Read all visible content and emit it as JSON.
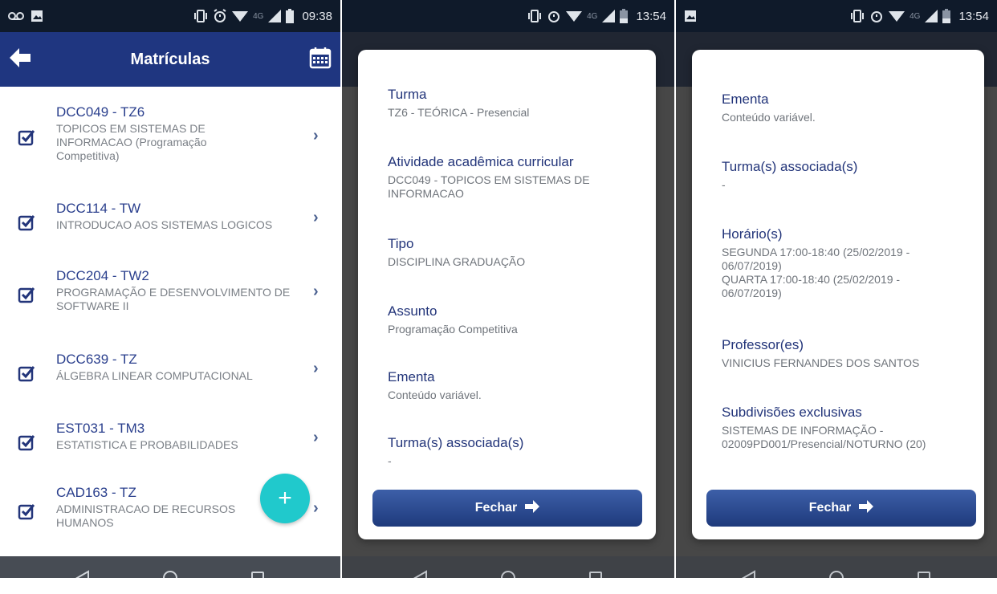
{
  "screens": [
    {
      "status": {
        "time": "09:38",
        "network": "4G"
      },
      "header": {
        "title": "Matrículas"
      },
      "items": [
        {
          "code": "DCC049 - TZ6",
          "desc": "TOPICOS EM SISTEMAS DE INFORMACAO (Programação Competitiva)"
        },
        {
          "code": "DCC114 - TW",
          "desc": "INTRODUCAO AOS SISTEMAS LOGICOS"
        },
        {
          "code": "DCC204 - TW2",
          "desc": "PROGRAMAÇÃO E DESENVOLVIMENTO DE SOFTWARE II"
        },
        {
          "code": "DCC639 - TZ",
          "desc": "ÁLGEBRA LINEAR COMPUTACIONAL"
        },
        {
          "code": "EST031 - TM3",
          "desc": "ESTATISTICA E PROBABILIDADES"
        },
        {
          "code": "CAD163 - TZ",
          "desc": "ADMINISTRACAO DE RECURSOS HUMANOS"
        }
      ],
      "fab_label": "+"
    },
    {
      "status": {
        "time": "13:54",
        "network": "4G"
      },
      "fields": [
        {
          "label": "Turma",
          "value": "TZ6 - TEÓRICA - Presencial"
        },
        {
          "label": "Atividade acadêmica curricular",
          "value": "DCC049 - TOPICOS EM SISTEMAS DE INFORMACAO"
        },
        {
          "label": "Tipo",
          "value": "DISCIPLINA GRADUAÇÃO"
        },
        {
          "label": "Assunto",
          "value": "Programação Competitiva"
        },
        {
          "label": "Ementa",
          "value": "Conteúdo variável."
        },
        {
          "label": "Turma(s) associada(s)",
          "value": "-"
        }
      ],
      "button": "Fechar"
    },
    {
      "status": {
        "time": "13:54",
        "network": "4G"
      },
      "fields": [
        {
          "label": "Ementa",
          "value": "Conteúdo variável."
        },
        {
          "label": "Turma(s) associada(s)",
          "value": "-"
        },
        {
          "label": "Horário(s)",
          "value": "SEGUNDA 17:00-18:40 (25/02/2019 - 06/07/2019)",
          "value2": "QUARTA 17:00-18:40 (25/02/2019 - 06/07/2019)"
        },
        {
          "label": "Professor(es)",
          "value": "VINICIUS FERNANDES DOS SANTOS"
        },
        {
          "label": "Subdivisões exclusivas",
          "value": "SISTEMAS DE INFORMAÇÃO - 02009PD001/Presencial/NOTURNO (20)"
        }
      ],
      "button": "Fechar"
    }
  ],
  "icons": {
    "back": "arrow-left-icon",
    "calendar": "calendar-icon",
    "checkbox": "checkbox-checked-icon",
    "chevron": "chevron-right-icon",
    "fab": "plus-icon"
  },
  "colors": {
    "appbar": "#1f3680",
    "accent": "#20c9cc",
    "text_primary": "#2a3f8d"
  }
}
